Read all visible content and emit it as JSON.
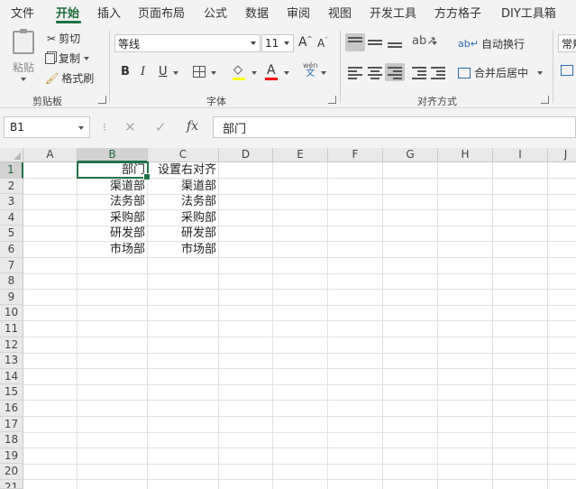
{
  "menu": {
    "tabs": [
      "文件",
      "开始",
      "插入",
      "页面布局",
      "公式",
      "数据",
      "审阅",
      "视图",
      "开发工具",
      "方方格子",
      "DIY工具箱"
    ],
    "active": "开始"
  },
  "ribbon": {
    "clipboard": {
      "paste": "粘贴",
      "cut": "剪切",
      "copy": "复制",
      "format_painter": "格式刷",
      "label": "剪贴板"
    },
    "font": {
      "name": "等线",
      "size": "11",
      "bold": "B",
      "italic": "I",
      "underline": "U",
      "grow": "A",
      "shrink": "A",
      "phonetic_top": "wén",
      "phonetic_bottom": "文",
      "highlight_color": "#ffff00",
      "font_color": "#ff0000",
      "label": "字体"
    },
    "alignment": {
      "wrap_text": "自动换行",
      "merge_center": "合并后居中",
      "label": "对齐方式"
    },
    "number": {
      "format": "常规"
    }
  },
  "formula_bar": {
    "name_box": "B1",
    "cancel": "✕",
    "enter": "✓",
    "fx": "fx",
    "content": "部门"
  },
  "grid": {
    "columns": [
      "A",
      "B",
      "C",
      "D",
      "E",
      "F",
      "G",
      "H",
      "I",
      "J"
    ],
    "rows": [
      "1",
      "2",
      "3",
      "4",
      "5",
      "6",
      "7",
      "8",
      "9",
      "10",
      "11",
      "12",
      "13",
      "14",
      "15",
      "16",
      "17",
      "18",
      "19",
      "20",
      "21"
    ],
    "selected_column": "B",
    "selected_row": "1",
    "cells": {
      "B1": "部门",
      "C1": "设置右对齐",
      "B2": "渠道部",
      "C2": "渠道部",
      "B3": "法务部",
      "C3": "法务部",
      "B4": "采购部",
      "C4": "采购部",
      "B5": "研发部",
      "C5": "研发部",
      "B6": "市场部",
      "C6": "市场部"
    }
  },
  "colors": {
    "accent": "#217346"
  }
}
